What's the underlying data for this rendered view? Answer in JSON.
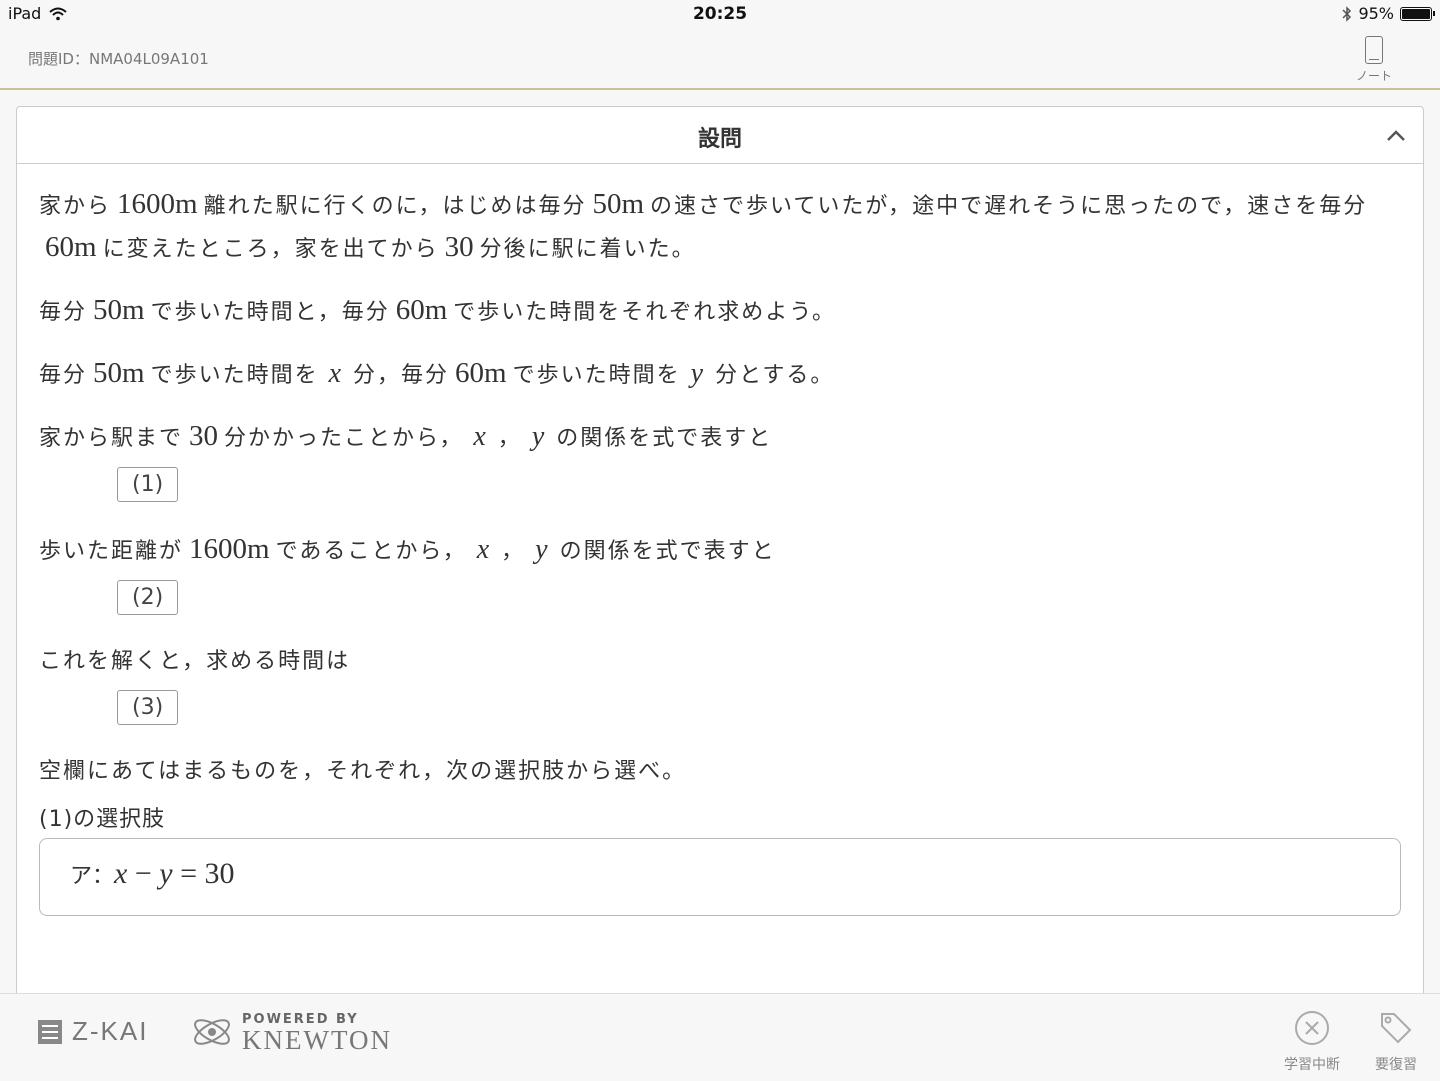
{
  "status_bar": {
    "device": "iPad",
    "time": "20:25",
    "battery": "95%"
  },
  "header": {
    "problem_id": "問題ID：NMA04L09A101",
    "note_label": "ノート"
  },
  "card": {
    "title": "設問",
    "p1": {
      "a": "家から",
      "n1": "1600m",
      "b": "離れた駅に行くのに，はじめは毎分",
      "n2": "50m",
      "c": "の速さで歩いていたが，途中で遅れそうに思ったので，速さを毎分",
      "n3": "60m",
      "d": "に変えたところ，家を出てから",
      "n4": "30",
      "e": "分後に駅に着いた。"
    },
    "p2": {
      "a": "毎分",
      "n1": "50m",
      "b": "で歩いた時間と，毎分",
      "n2": "60m",
      "c": "で歩いた時間をそれぞれ求めよう。"
    },
    "p3": {
      "a": "毎分",
      "n1": "50m",
      "b": "で歩いた時間を",
      "x": "x",
      "c": "分，毎分",
      "n2": "60m",
      "d": "で歩いた時間を",
      "y": "y",
      "e": "分とする。"
    },
    "p4": {
      "a": "家から駅まで",
      "n1": "30",
      "b": "分かかったことから，",
      "x": "x",
      "sep": "，",
      "y": "y",
      "c": "の関係を式で表すと"
    },
    "blank1": "(1)",
    "p5": {
      "a": "歩いた距離が",
      "n1": "1600m",
      "b": "であることから，",
      "x": "x",
      "sep": "，",
      "y": "y",
      "c": "の関係を式で表すと"
    },
    "blank2": "(2)",
    "p6": "これを解くと，求める時間は",
    "blank3": "(3)",
    "p7": "空欄にあてはまるものを，それぞれ，次の選択肢から選べ。",
    "choice_label": "(1)の選択肢",
    "choice_a": {
      "prefix": "ア：",
      "x": "x",
      "minus": " − ",
      "y": "y",
      "rhs": " = 30"
    }
  },
  "footer": {
    "zkai": "Z-KAI",
    "powered_by": "POWERED BY",
    "knewton": "KNEWTON",
    "pause_label": "学習中断",
    "review_label": "要復習"
  }
}
